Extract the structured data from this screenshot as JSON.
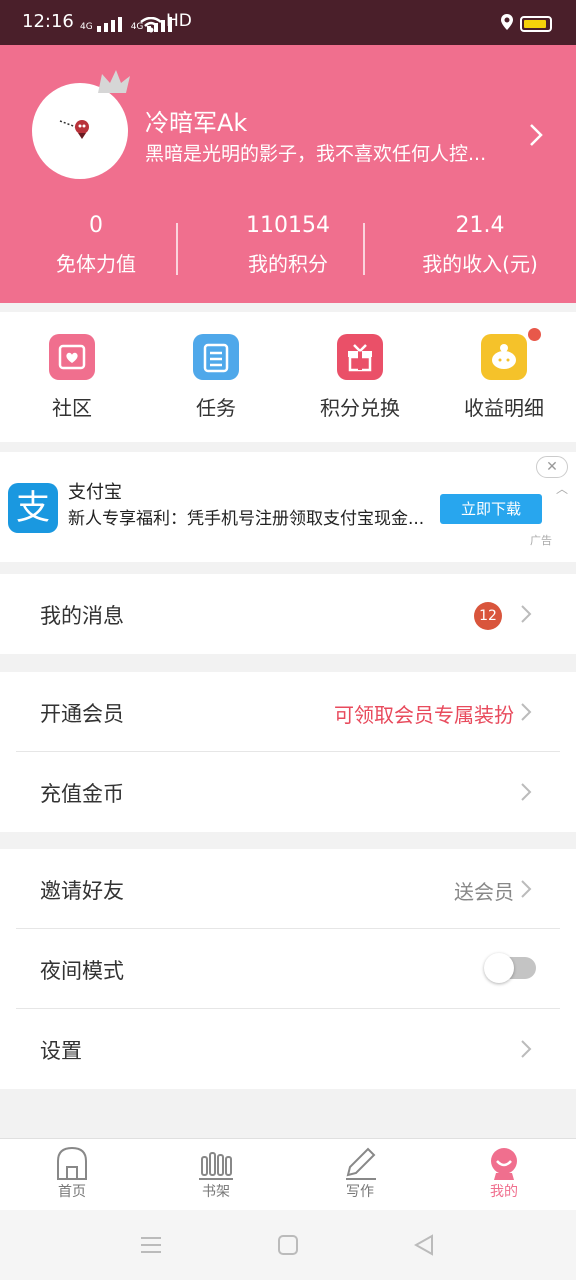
{
  "status": {
    "time": "12:16",
    "net1": "4G",
    "net2": "4G",
    "hd": "HD"
  },
  "profile": {
    "name": "冷暗军Ak",
    "bio": "黑暗是光明的影子，我不喜欢任何人控..."
  },
  "stats": [
    {
      "value": "0",
      "label": "免体力值"
    },
    {
      "value": "110154",
      "label": "我的积分"
    },
    {
      "value": "21.4",
      "label": "我的收入(元)"
    }
  ],
  "grid": [
    {
      "label": "社区",
      "color": "#f06f8e",
      "icon": "envelope-heart-icon"
    },
    {
      "label": "任务",
      "color": "#4fa8ea",
      "icon": "checklist-icon"
    },
    {
      "label": "积分兑换",
      "color": "#ea5068",
      "icon": "gift-icon"
    },
    {
      "label": "收益明细",
      "color": "#f5c22a",
      "icon": "piggy-bank-icon"
    }
  ],
  "ad": {
    "app_name": "支付宝",
    "description": "新人专享福利：凭手机号注册领取支付宝现金...",
    "button": "立即下载",
    "tag": "广告",
    "logo_char": "支",
    "close": "✕"
  },
  "messages": {
    "label": "我的消息",
    "badge": "12"
  },
  "vip": {
    "label": "开通会员",
    "value": "可领取会员专属装扮",
    "value_color": "#e84a5c"
  },
  "recharge": {
    "label": "充值金币"
  },
  "invite": {
    "label": "邀请好友",
    "value": "送会员"
  },
  "night": {
    "label": "夜间模式",
    "enabled": false
  },
  "settings": {
    "label": "设置"
  },
  "tabs": [
    {
      "label": "首页",
      "icon": "home-icon"
    },
    {
      "label": "书架",
      "icon": "bookshelf-icon"
    },
    {
      "label": "写作",
      "icon": "pencil-icon"
    },
    {
      "label": "我的",
      "icon": "profile-icon",
      "active": true
    }
  ]
}
